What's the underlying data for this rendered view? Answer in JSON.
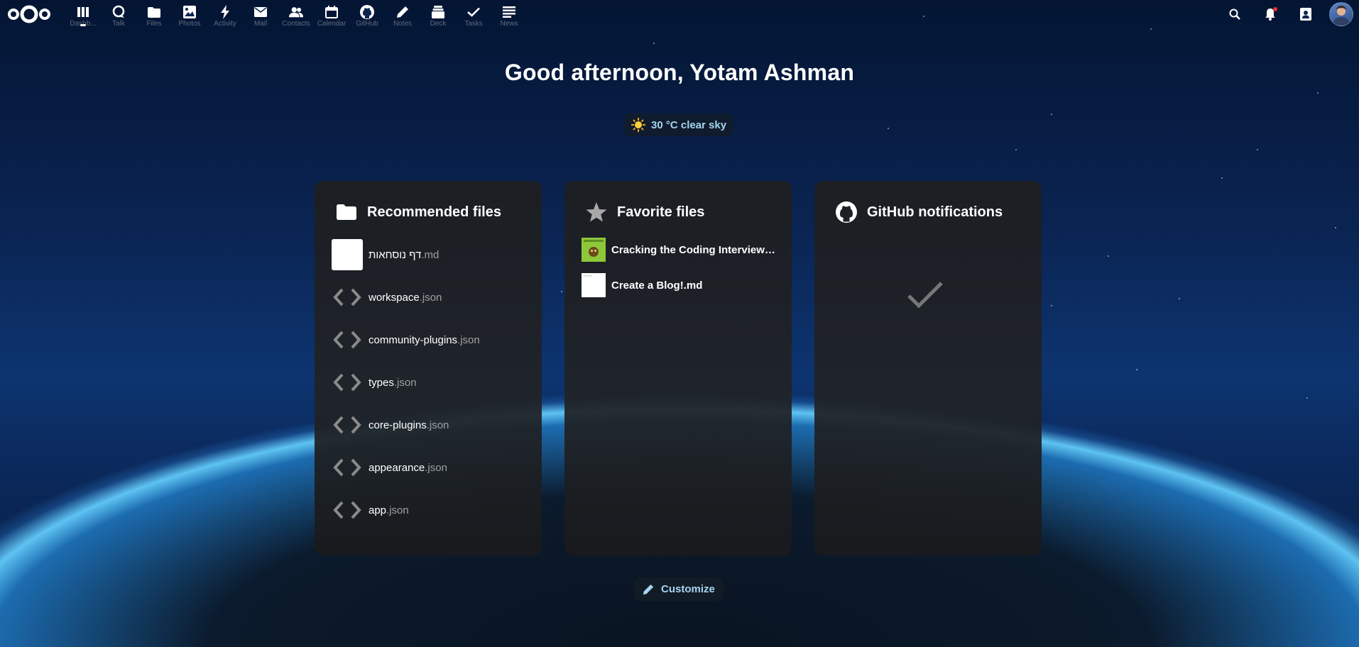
{
  "topbar": {
    "apps": [
      {
        "label": "Dashb...",
        "icon": "dashboard-icon",
        "active": true
      },
      {
        "label": "Talk",
        "icon": "talk-icon"
      },
      {
        "label": "Files",
        "icon": "folder-icon"
      },
      {
        "label": "Photos",
        "icon": "image-icon"
      },
      {
        "label": "Activity",
        "icon": "lightning-icon"
      },
      {
        "label": "Mail",
        "icon": "mail-icon"
      },
      {
        "label": "Contacts",
        "icon": "contacts-icon"
      },
      {
        "label": "Calendar",
        "icon": "calendar-icon"
      },
      {
        "label": "GitHub",
        "icon": "github-icon"
      },
      {
        "label": "Notes",
        "icon": "pencil-icon"
      },
      {
        "label": "Deck",
        "icon": "deck-icon"
      },
      {
        "label": "Tasks",
        "icon": "check-icon"
      },
      {
        "label": "News",
        "icon": "news-icon"
      }
    ]
  },
  "greeting": "Good afternoon, Yotam Ashman",
  "weather": {
    "text": "30 °C clear sky",
    "icon": "sun-icon"
  },
  "recommended": {
    "title": "Recommended files",
    "files": [
      {
        "name": "דף נוסחאות",
        "ext": ".md",
        "icon": "document-thumbnail"
      },
      {
        "name": "workspace",
        "ext": ".json",
        "icon": "code-icon"
      },
      {
        "name": "community-plugins",
        "ext": ".json",
        "icon": "code-icon"
      },
      {
        "name": "types",
        "ext": ".json",
        "icon": "code-icon"
      },
      {
        "name": "core-plugins",
        "ext": ".json",
        "icon": "code-icon"
      },
      {
        "name": "appearance",
        "ext": ".json",
        "icon": "code-icon"
      },
      {
        "name": "app",
        "ext": ".json",
        "icon": "code-icon"
      }
    ]
  },
  "favorites": {
    "title": "Favorite files",
    "files": [
      {
        "name": "Cracking the Coding Interview -...",
        "thumb": "book-cover-thumbnail"
      },
      {
        "name": "Create a Blog!.md",
        "thumb": "document-thumbnail"
      }
    ]
  },
  "github": {
    "title": "GitHub notifications",
    "empty_icon": "check-icon"
  },
  "customize_label": "Customize",
  "colors": {
    "accent": "#a6d4f0",
    "panel": "#1e2023",
    "notification_dot": "#e9322d"
  }
}
